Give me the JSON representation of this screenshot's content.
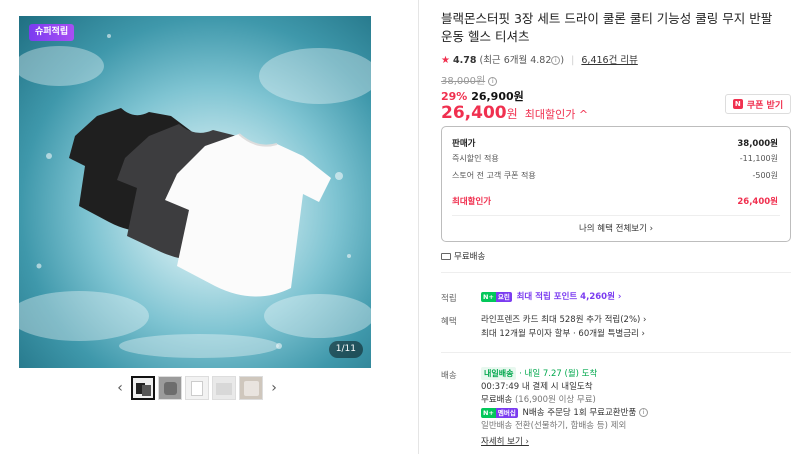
{
  "gallery": {
    "badge": "슈퍼적립",
    "counter": "1/11",
    "prev_arrow": "‹",
    "next_arrow": "›",
    "thumb_count": 5,
    "colors": {
      "shirt_black": "#1f1f1f",
      "shirt_gray": "#3d3d3f",
      "shirt_white": "#fbfbfb",
      "water": "#3f98ab"
    }
  },
  "product": {
    "title": "블랙몬스터핏 3장 세트 드라이 쿨론 쿨티 기능성 쿨링 무지 반팔 운동 헬스 티셔츠",
    "rating": {
      "star": "★",
      "score": "4.78",
      "recent": "(최근 6개월 4.82",
      "recent_close": ")",
      "reviews": "6,416건 리뷰"
    },
    "original_price": "38,000원",
    "discount_pct": "29%",
    "discount_price": "26,900원",
    "max_discount_price": "26,400",
    "max_discount_won": "원",
    "max_discount_label": "최대할인가 ^",
    "coupon_button": "쿠폰 받기",
    "coupon_mark": "N"
  },
  "price_box": {
    "rows": [
      {
        "label": "판매가",
        "value": "38,000원"
      },
      {
        "label": "즉시할인 적용",
        "value": "-11,100원"
      },
      {
        "label": "스토어 전 고객 쿠폰 적용",
        "value": "-500원"
      },
      {
        "label": "최대할인가",
        "value": "26,400원"
      }
    ],
    "benefit_link": "나의 혜택 전체보기 ›"
  },
  "shipping_free": "무료배송",
  "points": {
    "label": "적립",
    "badge_n": "N+",
    "badge_p": "요린",
    "text": "최대 적립 포인트 4,260원 ›"
  },
  "benefits": {
    "label": "혜택",
    "line1": "라인프렌즈 카드 최대 528원 추가 적립(2%) ›",
    "line2": "최대 12개월 무이자 할부 · 60개월 특별금리 ›"
  },
  "delivery": {
    "label": "배송",
    "badge": "내일배송",
    "arrival": "· 내일 7.27 (월) 도착",
    "cutoff": "00:37:49  내 결제 시 내일도착",
    "free": "무료배송",
    "free_note": "(16,900원 이상 무료)",
    "return_badge_n": "N+",
    "return_badge_p": "멤버십",
    "return_text": "N배송 주문당 1회 무료교환반품",
    "normal": "일반배송 전환(선물하기, 합배송 등) 제외",
    "detail_link": "자세히 보기 ›"
  }
}
